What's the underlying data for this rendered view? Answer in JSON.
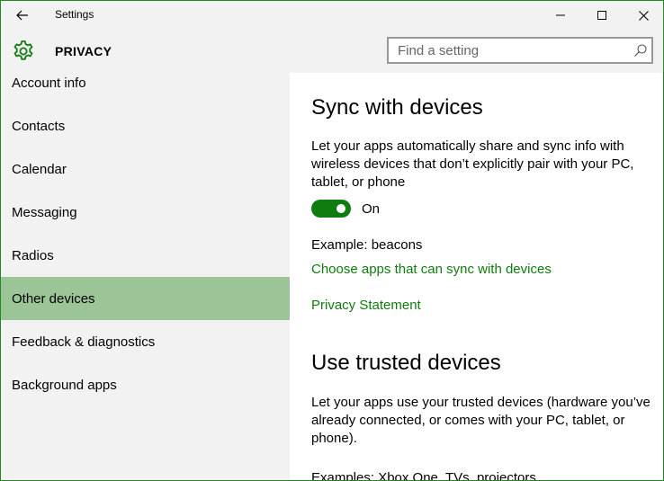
{
  "window": {
    "title": "Settings"
  },
  "header": {
    "title": "PRIVACY",
    "search_placeholder": "Find a setting"
  },
  "sidebar": {
    "items": [
      {
        "label": "Account info",
        "selected": false
      },
      {
        "label": "Contacts",
        "selected": false
      },
      {
        "label": "Calendar",
        "selected": false
      },
      {
        "label": "Messaging",
        "selected": false
      },
      {
        "label": "Radios",
        "selected": false
      },
      {
        "label": "Other devices",
        "selected": true
      },
      {
        "label": "Feedback & diagnostics",
        "selected": false
      },
      {
        "label": "Background apps",
        "selected": false
      }
    ]
  },
  "content": {
    "sync_heading": "Sync with devices",
    "sync_description": "Let your apps automatically share and sync info with wireless devices that don’t explicitly pair with your PC, tablet, or phone",
    "sync_toggle_state": "On",
    "sync_example": "Example: beacons",
    "choose_apps_link": "Choose apps that can sync with devices",
    "privacy_statement_link": "Privacy Statement",
    "trusted_heading": "Use trusted devices",
    "trusted_description": "Let your apps use your trusted devices (hardware you’ve already connected, or comes with your PC, tablet, or phone).",
    "trusted_examples": "Examples: Xbox One, TVs, projectors"
  },
  "colors": {
    "accent": "#107c10",
    "selected_bg": "#9bc596",
    "chrome_bg": "#f2f2f2",
    "window_border": "#1e8a1e"
  },
  "icons": {
    "back": "back-arrow-icon",
    "minimize": "minimize-icon",
    "maximize": "maximize-icon",
    "close": "close-icon",
    "settings": "gear-icon",
    "search": "search-icon"
  }
}
